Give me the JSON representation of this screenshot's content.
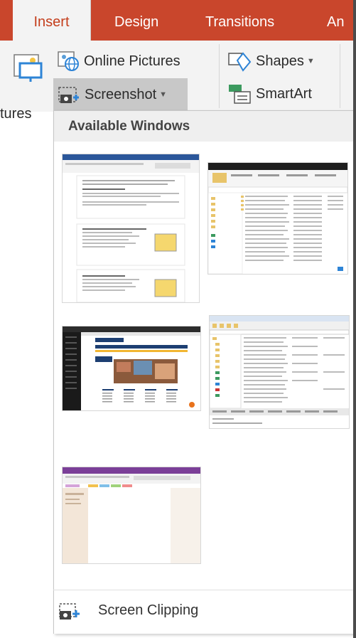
{
  "ribbon": {
    "tabs": [
      "Insert",
      "Design",
      "Transitions",
      "An"
    ],
    "active_tab": "Insert",
    "accent": "#c9462c",
    "commands": {
      "online_pictures": "Online Pictures",
      "screenshot": "Screenshot",
      "shapes": "Shapes",
      "smartart": "SmartArt",
      "pictures_fragment": "tures"
    }
  },
  "dropdown": {
    "header": "Available Windows",
    "thumbnails": [
      {
        "name": "word-document-window"
      },
      {
        "name": "file-explorer-window"
      },
      {
        "name": "browser-website-window"
      },
      {
        "name": "explorer-file-list-window"
      },
      {
        "name": "onenote-window"
      }
    ],
    "screen_clipping": "Screen Clipping"
  }
}
